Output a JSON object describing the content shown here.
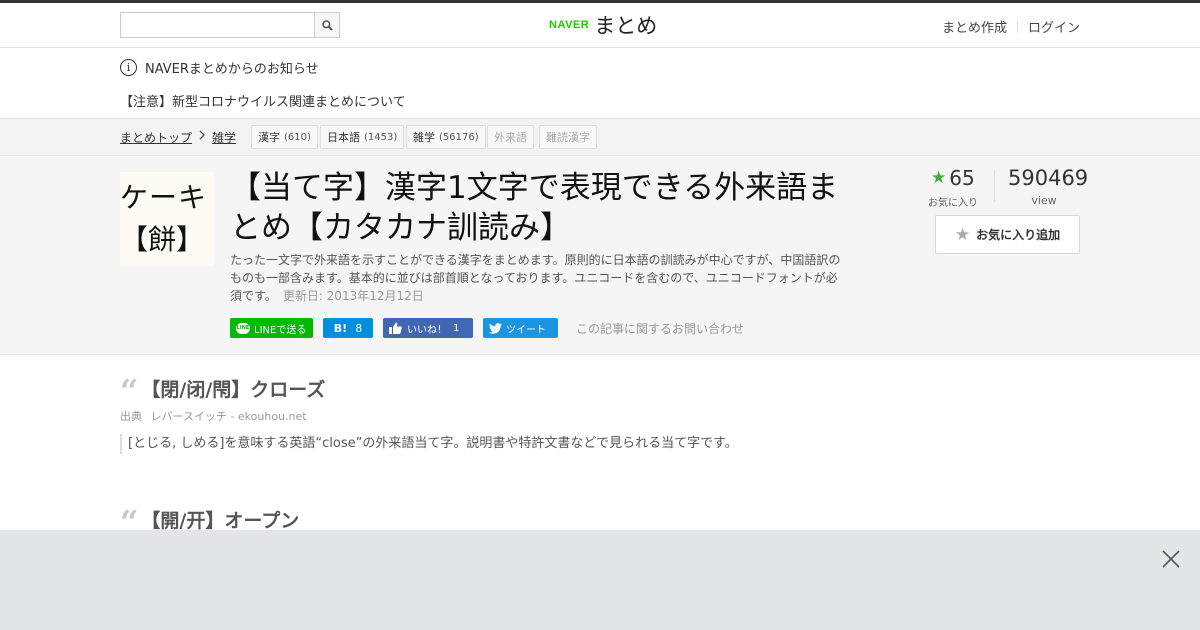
{
  "header": {
    "search": {
      "placeholder": ""
    },
    "logo": {
      "naver": "NAVER",
      "matome": "まとめ"
    },
    "links": {
      "create": "まとめ作成",
      "login": "ログイン"
    }
  },
  "notice": {
    "info_text": "NAVERまとめからのお知らせ",
    "warning_link": "【注意】新型コロナウイルス関連まとめについて"
  },
  "breadcrumb": {
    "items": [
      "まとめトップ",
      "雑学"
    ],
    "tags": [
      {
        "label": "漢字",
        "count": "(610)"
      },
      {
        "label": "日本語",
        "count": "(1453)"
      },
      {
        "label": "雑学",
        "count": "(56176)"
      },
      {
        "label": "外来語",
        "count": ""
      },
      {
        "label": "難読漢字",
        "count": ""
      }
    ]
  },
  "article": {
    "thumbnail": {
      "line1": "ケーキ",
      "line2": "【餅】"
    },
    "title": "【当て字】漢字1文字で表現できる外来語まとめ【カタカナ訓読み】",
    "description": "たった一文字で外来語を示すことができる漢字をまとめます。原則的に日本語の訓読みが中心ですが、中国語訳のものも一部含みます。基本的に並びは部首順となっております。ユニコードを含むので、ユニコードフォントが必須です。",
    "updated": "更新日: 2013年12月12日",
    "favorites": "65",
    "favorites_label": "お気に入り",
    "views": "590469",
    "views_label": "view",
    "fav_button": "お気に入り追加",
    "share": {
      "line": "LINEで送る",
      "line_icon": "LINE",
      "hatena_icon": "B!",
      "hatena_count": "8",
      "fb": "いいね！",
      "fb_count": "1",
      "tweet": "ツイート",
      "contact": "この記事に関するお問い合わせ"
    }
  },
  "content": {
    "items": [
      {
        "heading": "【閉/闭/閇】クローズ",
        "source_label": "出典",
        "source": "レバースイッチ - ekouhou.net",
        "quote": "[とじる, しめる]を意味する英語“close”の外来語当て字。説明書や特許文書などで見られる当て字です。"
      },
      {
        "heading": "【開/开】オープン"
      }
    ]
  },
  "colors": {
    "accent_green": "#1ec800",
    "star_green": "#3cb034",
    "line": "#00b900",
    "hatena": "#008fde",
    "facebook": "#4267b2",
    "twitter": "#1b95e0"
  }
}
